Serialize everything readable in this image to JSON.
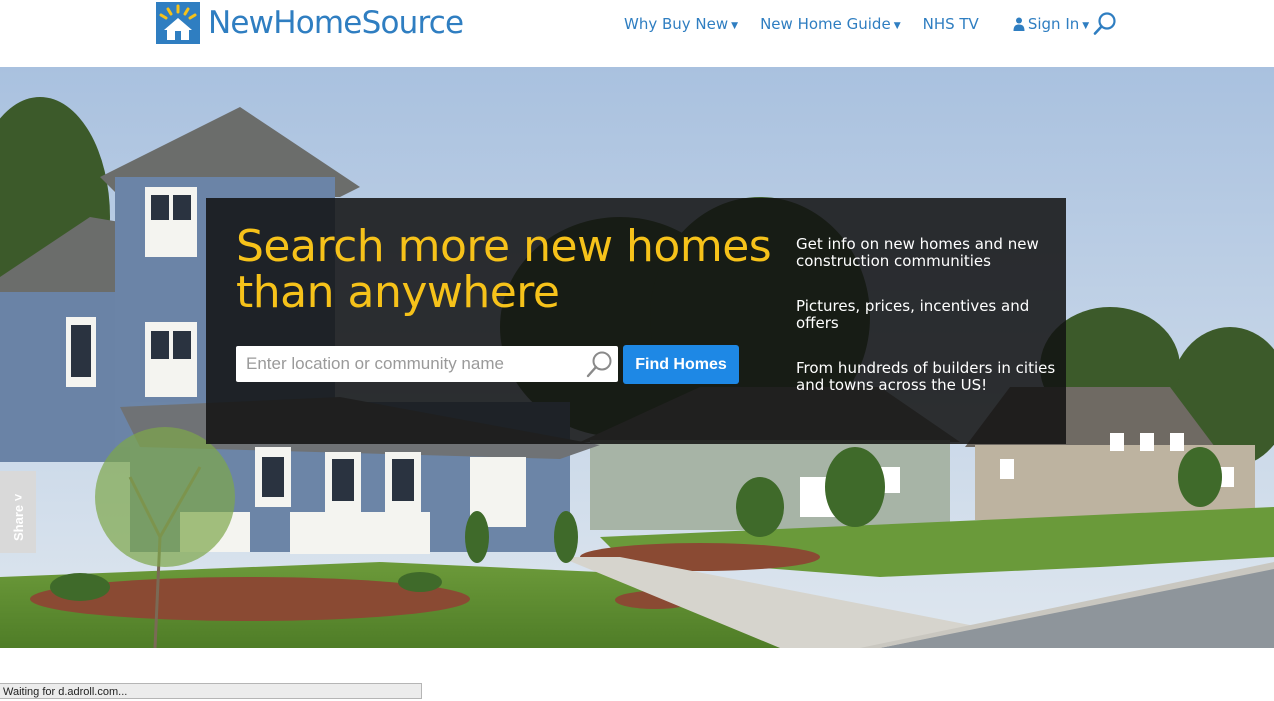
{
  "brand": {
    "name": "NewHomeSource",
    "logo_icon": "house-icon",
    "color": "#2f7ec1"
  },
  "nav": {
    "items": [
      {
        "label": "Why Buy New",
        "has_dropdown": true
      },
      {
        "label": "New Home Guide",
        "has_dropdown": true
      },
      {
        "label": "NHS TV",
        "has_dropdown": false
      },
      {
        "label": "Sign In",
        "has_dropdown": true,
        "icon": "person-icon"
      }
    ],
    "search_icon": "search-icon"
  },
  "hero": {
    "headline": "Search more new homes than anywhere",
    "headline_color": "#f6c21a",
    "search": {
      "placeholder": "Enter location or community name",
      "value": "",
      "icon": "search-icon"
    },
    "find_button": "Find Homes",
    "find_button_color": "#1e88e5",
    "bullets": [
      "Get info on new homes and new construction communities",
      "Pictures, prices, incentives and offers",
      "From hundreds of builders in cities and towns across the US!"
    ]
  },
  "share_tab": {
    "label": "Share ˅"
  },
  "status_bar": {
    "text": "Waiting for d.adroll.com..."
  }
}
